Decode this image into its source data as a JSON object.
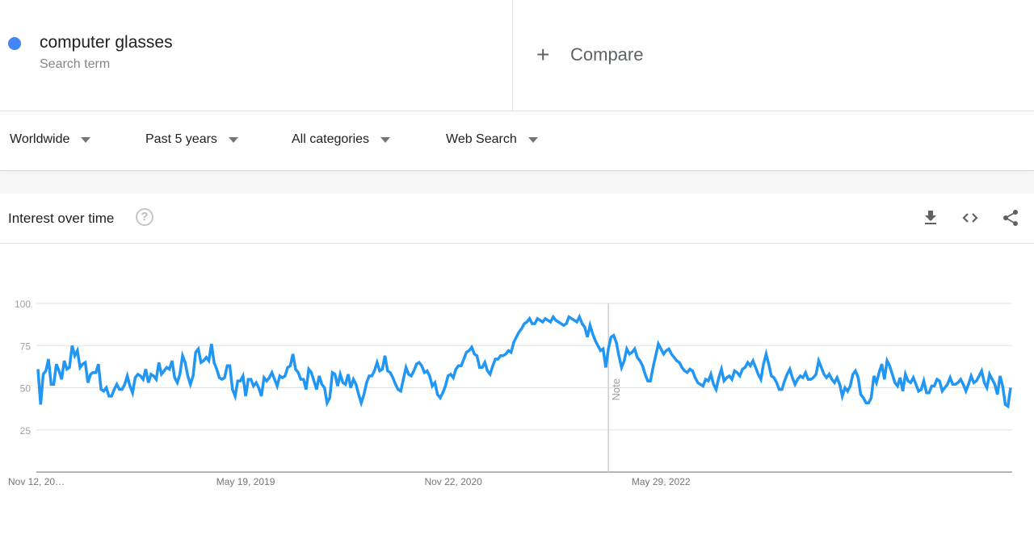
{
  "search_term": {
    "name": "computer glasses",
    "type": "Search term",
    "color": "#4285f4"
  },
  "compare": {
    "icon": "plus-icon",
    "label": "Compare"
  },
  "filters": [
    {
      "label": "Worldwide"
    },
    {
      "label": "Past 5 years"
    },
    {
      "label": "All categories"
    },
    {
      "label": "Web Search"
    }
  ],
  "card": {
    "title": "Interest over time",
    "help_icon": "?",
    "actions": [
      "download-icon",
      "embed-code-icon",
      "share-icon"
    ]
  },
  "chart_data": {
    "type": "line",
    "title": "Interest over time",
    "xlabel": "",
    "ylabel": "",
    "ylim": [
      0,
      100
    ],
    "yticks": [
      25,
      50,
      75,
      100
    ],
    "xtick_labels": [
      "Nov 12, 20…",
      "May 19, 2019",
      "Nov 22, 2020",
      "May 29, 2022"
    ],
    "xtick_positions": [
      0,
      79,
      158,
      237
    ],
    "annotation": {
      "label": "Note",
      "index": 217
    },
    "grid": true,
    "legend": "none",
    "series": [
      {
        "name": "computer glasses",
        "color": "#2196f3",
        "values": [
          61,
          40,
          58,
          60,
          67,
          52,
          52,
          64,
          60,
          55,
          66,
          61,
          62,
          75,
          69,
          72,
          62,
          64,
          65,
          53,
          58,
          59,
          59,
          64,
          49,
          48,
          50,
          45,
          45,
          49,
          52,
          49,
          49,
          52,
          57,
          51,
          47,
          56,
          58,
          57,
          55,
          61,
          53,
          58,
          57,
          55,
          65,
          58,
          60,
          62,
          61,
          66,
          56,
          53,
          58,
          69,
          65,
          57,
          52,
          57,
          71,
          73,
          65,
          66,
          68,
          66,
          76,
          65,
          61,
          56,
          55,
          56,
          63,
          63,
          49,
          45,
          54,
          54,
          57,
          45,
          55,
          55,
          51,
          53,
          50,
          45,
          56,
          54,
          56,
          59,
          55,
          51,
          57,
          56,
          57,
          62,
          63,
          70,
          61,
          59,
          55,
          55,
          49,
          61,
          59,
          54,
          49,
          57,
          52,
          50,
          41,
          44,
          59,
          58,
          51,
          58,
          53,
          52,
          58,
          50,
          55,
          52,
          46,
          41,
          46,
          53,
          57,
          57,
          60,
          65,
          60,
          61,
          69,
          60,
          59,
          56,
          52,
          49,
          48,
          55,
          62,
          58,
          57,
          60,
          64,
          65,
          63,
          59,
          60,
          57,
          51,
          53,
          46,
          44,
          47,
          51,
          57,
          58,
          56,
          61,
          63,
          63,
          67,
          71,
          72,
          74,
          70,
          69,
          62,
          62,
          65,
          60,
          58,
          63,
          67,
          67,
          69,
          69,
          70,
          72,
          71,
          77,
          80,
          83,
          85,
          88,
          89,
          91,
          88,
          88,
          91,
          90,
          89,
          91,
          90,
          89,
          92,
          90,
          89,
          88,
          87,
          88,
          92,
          91,
          90,
          89,
          92,
          88,
          86,
          80,
          87,
          82,
          78,
          75,
          72,
          73,
          62,
          73,
          80,
          81,
          77,
          69,
          62,
          66,
          73,
          70,
          71,
          73,
          68,
          66,
          63,
          58,
          54,
          54,
          62,
          69,
          76,
          73,
          70,
          72,
          73,
          70,
          68,
          66,
          65,
          62,
          60,
          59,
          61,
          60,
          56,
          53,
          52,
          51,
          55,
          54,
          58,
          52,
          49,
          56,
          61,
          54,
          56,
          57,
          55,
          60,
          59,
          57,
          61,
          62,
          65,
          63,
          66,
          62,
          58,
          55,
          64,
          70,
          64,
          57,
          56,
          53,
          49,
          49,
          54,
          58,
          61,
          56,
          52,
          55,
          57,
          56,
          59,
          55,
          55,
          56,
          58,
          66,
          62,
          58,
          56,
          58,
          55,
          53,
          56,
          52,
          45,
          50,
          48,
          51,
          58,
          60,
          56,
          46,
          44,
          41,
          41,
          44,
          57,
          53,
          59,
          64,
          55,
          66,
          63,
          58,
          53,
          51,
          56,
          48,
          58,
          54,
          53,
          56,
          52,
          48,
          49,
          54,
          47,
          47,
          51,
          51,
          55,
          54,
          48,
          50,
          52,
          56,
          52,
          52,
          53,
          55,
          52,
          48,
          52,
          57,
          53,
          54,
          57,
          60,
          53,
          50,
          58,
          55,
          52,
          46,
          57,
          51,
          40,
          39,
          50
        ],
        "note": "weekly search interest, values estimated from rendered line"
      }
    ]
  }
}
